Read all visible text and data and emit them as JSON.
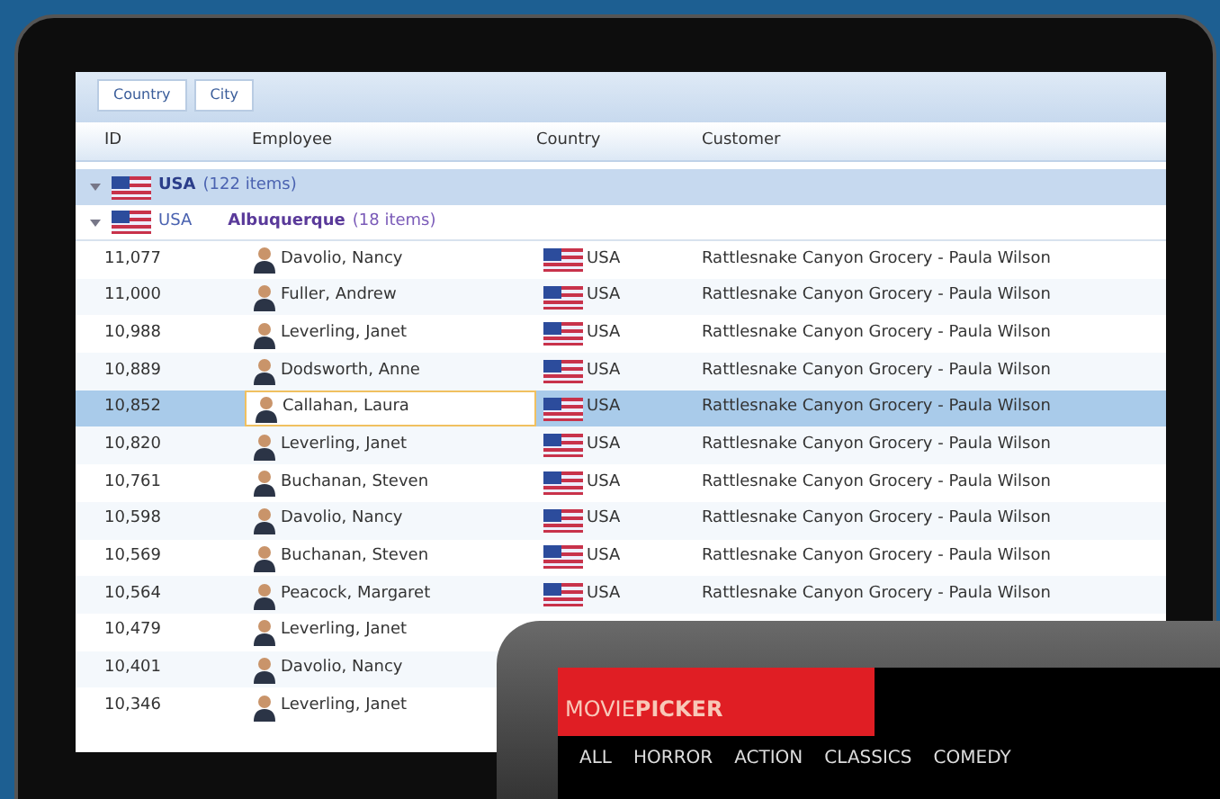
{
  "grid": {
    "group_panel": [
      "Country",
      "City"
    ],
    "columns": [
      "ID",
      "Employee",
      "Country",
      "Customer"
    ],
    "group": {
      "label": "USA",
      "count": "(122 items)",
      "expanded": true
    },
    "subgroup": {
      "country": "USA",
      "label": "Albuquerque",
      "count": "(18 items)",
      "expanded": true
    },
    "rows": [
      {
        "id": "11,077",
        "employee": "Davolio, Nancy",
        "country": "USA",
        "customer": "Rattlesnake Canyon Grocery - Paula Wilson",
        "selected": false
      },
      {
        "id": "11,000",
        "employee": "Fuller, Andrew",
        "country": "USA",
        "customer": "Rattlesnake Canyon Grocery - Paula Wilson",
        "selected": false
      },
      {
        "id": "10,988",
        "employee": "Leverling, Janet",
        "country": "USA",
        "customer": "Rattlesnake Canyon Grocery - Paula Wilson",
        "selected": false
      },
      {
        "id": "10,889",
        "employee": "Dodsworth, Anne",
        "country": "USA",
        "customer": "Rattlesnake Canyon Grocery - Paula Wilson",
        "selected": false
      },
      {
        "id": "10,852",
        "employee": "Callahan, Laura",
        "country": "USA",
        "customer": "Rattlesnake Canyon Grocery - Paula Wilson",
        "selected": true
      },
      {
        "id": "10,820",
        "employee": "Leverling, Janet",
        "country": "USA",
        "customer": "Rattlesnake Canyon Grocery - Paula Wilson",
        "selected": false
      },
      {
        "id": "10,761",
        "employee": "Buchanan, Steven",
        "country": "USA",
        "customer": "Rattlesnake Canyon Grocery - Paula Wilson",
        "selected": false
      },
      {
        "id": "10,598",
        "employee": "Davolio, Nancy",
        "country": "USA",
        "customer": "Rattlesnake Canyon Grocery - Paula Wilson",
        "selected": false
      },
      {
        "id": "10,569",
        "employee": "Buchanan, Steven",
        "country": "USA",
        "customer": "Rattlesnake Canyon Grocery - Paula Wilson",
        "selected": false
      },
      {
        "id": "10,564",
        "employee": "Peacock, Margaret",
        "country": "USA",
        "customer": "Rattlesnake Canyon Grocery - Paula Wilson",
        "selected": false
      },
      {
        "id": "10,479",
        "employee": "Leverling, Janet",
        "selected": false
      },
      {
        "id": "10,401",
        "employee": "Davolio, Nancy",
        "selected": false
      },
      {
        "id": "10,346",
        "employee": "Leverling, Janet",
        "selected": false
      }
    ]
  },
  "movie_picker": {
    "logo": "MOVIE**PICKER**",
    "categories": [
      "ALL",
      "HORROR",
      "ACTION",
      "CLASSICS",
      "COMEDY"
    ]
  }
}
